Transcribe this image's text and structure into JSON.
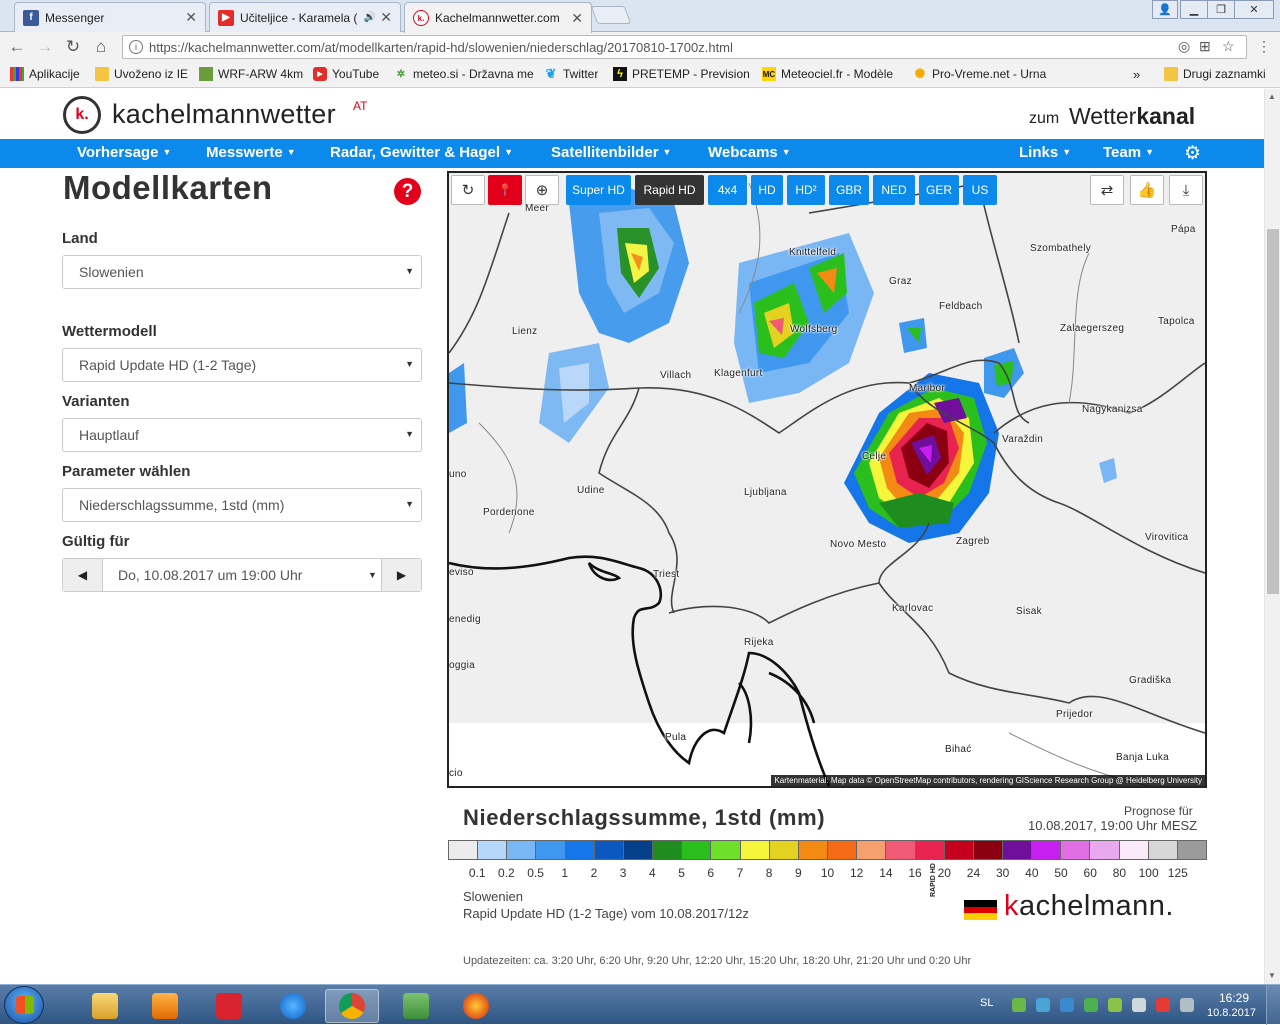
{
  "browser": {
    "tabs": [
      {
        "title": "Messenger",
        "favicon": "facebook-icon",
        "color": "#3b5998",
        "glyph": "f"
      },
      {
        "title": "Učiteljice - Karamela (",
        "favicon": "youtube-icon",
        "color": "#e52d27",
        "glyph": "▶",
        "audio": "🔊"
      },
      {
        "title": "Kachelmannwetter.com",
        "favicon": "kachelmann-icon",
        "color": "#e2001a",
        "glyph": "k."
      }
    ],
    "url": "https://kachelmannwetter.com/at/modellkarten/rapid-hd/slowenien/niederschlag/20170810-1700z.html",
    "bookmarks": [
      {
        "label": "Aplikacije",
        "icon": "apps-icon"
      },
      {
        "label": "Uvoženo iz IE",
        "icon": "folder-icon"
      },
      {
        "label": "WRF-ARW 4km",
        "icon": "wrf-icon"
      },
      {
        "label": "YouTube",
        "icon": "youtube-icon"
      },
      {
        "label": "meteo.si - Državna me",
        "icon": "meteo-icon"
      },
      {
        "label": "Twitter",
        "icon": "twitter-icon"
      },
      {
        "label": "PRETEMP - Previsione",
        "icon": "pretemp-icon"
      },
      {
        "label": "Meteociel.fr - Modèle",
        "icon": "meteociel-icon"
      },
      {
        "label": "Pro-Vreme.net - Urna",
        "icon": "sun-icon"
      }
    ],
    "bookmarks_more": "»",
    "other_bookmarks": "Drugi zaznamki"
  },
  "site": {
    "logo_text": "kachelmannwetter",
    "logo_country": "AT",
    "logo_mark": "k.",
    "channel_prefix": "zum",
    "channel_a": "Wetter",
    "channel_b": "kanal",
    "nav": [
      "Vorhersage",
      "Messwerte",
      "Radar, Gewitter & Hagel",
      "Satellitenbilder",
      "Webcams",
      "Links",
      "Team"
    ]
  },
  "sidebar": {
    "title": "Modellkarten",
    "help": "?",
    "land_label": "Land",
    "land_value": "Slowenien",
    "model_label": "Wettermodell",
    "model_value": "Rapid Update HD (1-2 Tage)",
    "variant_label": "Varianten",
    "variant_value": "Hauptlauf",
    "param_label": "Parameter wählen",
    "param_value": "Niederschlagssumme, 1std (mm)",
    "valid_label": "Gültig für",
    "valid_value": "Do, 10.08.2017 um 19:00 Uhr"
  },
  "map": {
    "buttons": [
      "Super HD",
      "Rapid HD",
      "4x4",
      "HD",
      "HD²",
      "GBR",
      "NED",
      "GER",
      "US"
    ],
    "active_button": "Rapid HD",
    "cities": [
      {
        "name": "Meer"
      },
      {
        "name": "Knittelfeld"
      },
      {
        "name": "Graz"
      },
      {
        "name": "Szombathely"
      },
      {
        "name": "Pápa"
      },
      {
        "name": "Feldbach"
      },
      {
        "name": "Lienz"
      },
      {
        "name": "Wolfsberg"
      },
      {
        "name": "Zalaegerszeg"
      },
      {
        "name": "Tapolca"
      },
      {
        "name": "Villach"
      },
      {
        "name": "Klagenfurt"
      },
      {
        "name": "Maribor"
      },
      {
        "name": "Nagykanizsa"
      },
      {
        "name": "Celje"
      },
      {
        "name": "Varaždin"
      },
      {
        "name": "uno"
      },
      {
        "name": "Udine"
      },
      {
        "name": "Ljubljana"
      },
      {
        "name": "Pordenone"
      },
      {
        "name": "Novo Mesto"
      },
      {
        "name": "Zagreb"
      },
      {
        "name": "Virovitica"
      },
      {
        "name": "eviso"
      },
      {
        "name": "Triest"
      },
      {
        "name": "Karlovac"
      },
      {
        "name": "Sisak"
      },
      {
        "name": "enedig"
      },
      {
        "name": "Rijeka"
      },
      {
        "name": "oggia"
      },
      {
        "name": "Gradiška"
      },
      {
        "name": "Prijedor"
      },
      {
        "name": "Pula"
      },
      {
        "name": "Bihać"
      },
      {
        "name": "Banja Luka"
      },
      {
        "name": "cio"
      }
    ],
    "attribution": "Kartenmaterial: Map data © OpenStreetMap contributors, rendering GIScience Research Group @ Heidelberg University"
  },
  "legend": {
    "title": "Niederschlagssumme, 1std (mm)",
    "prognose_label": "Prognose für",
    "prognose_value": "10.08.2017, 19:00 Uhr MESZ",
    "colors": [
      "#ececec",
      "#b6d6fa",
      "#79b7f4",
      "#3f98ee",
      "#1476e8",
      "#0b58c0",
      "#063f8a",
      "#1e8c1e",
      "#2bbf1d",
      "#6fe02a",
      "#f5f53c",
      "#e3d21f",
      "#f38a14",
      "#f56a17",
      "#f6a070",
      "#f05a75",
      "#e8234f",
      "#c4001c",
      "#8b0010",
      "#6f0f9b",
      "#c71fef",
      "#e06fe3",
      "#e9a9ef",
      "#faeafa",
      "#d7d7d7",
      "#9b9b9b"
    ],
    "ticks": [
      "0.1",
      "0.2",
      "0.5",
      "1",
      "2",
      "3",
      "4",
      "5",
      "6",
      "7",
      "8",
      "9",
      "10",
      "12",
      "14",
      "16",
      "20",
      "24",
      "30",
      "40",
      "50",
      "60",
      "80",
      "100",
      "125"
    ],
    "region": "Slowenien",
    "run": "Rapid Update HD (1-2 Tage) vom 10.08.2017/12z",
    "updates": "Updatezeiten: ca. 3:20 Uhr, 6:20 Uhr, 9:20 Uhr, 12:20 Uhr, 15:20 Uhr, 18:20 Uhr, 21:20 Uhr und 0:20 Uhr",
    "brand_tag": "RAPID HD",
    "brand_a": "k",
    "brand_b": "achelmann."
  },
  "taskbar": {
    "lang": "SL",
    "time": "16:29",
    "date": "10.8.2017"
  }
}
